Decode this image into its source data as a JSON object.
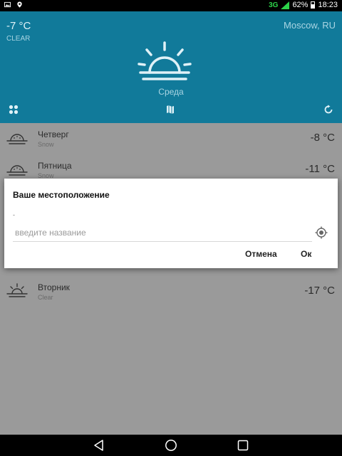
{
  "status_bar": {
    "network": "3G",
    "battery": "62%",
    "time": "18:23",
    "icons": [
      "image-icon",
      "location-icon",
      "signal-icon",
      "battery-icon"
    ]
  },
  "header": {
    "temperature": "-7 °C",
    "condition": "CLEAR",
    "location": "Moscow, RU",
    "day": "Среда",
    "icon": "sunrise-icon",
    "actions": [
      "grid-icon",
      "map-icon",
      "refresh-icon"
    ],
    "colors": {
      "background": "#117a9a"
    }
  },
  "forecast": [
    {
      "day": "Четверг",
      "condition": "Snow",
      "temp": "-8 °C",
      "icon": "snow-icon"
    },
    {
      "day": "Пятница",
      "condition": "Snow",
      "temp": "-11 °C",
      "icon": "snow-icon"
    },
    {
      "day": "Вторник",
      "condition": "Clear",
      "temp": "-17 °C",
      "icon": "sunrise-icon"
    }
  ],
  "dialog": {
    "title": "Ваше местоположение",
    "note": "-",
    "input_value": "",
    "input_placeholder": "введите название",
    "locate_icon": "gps-icon",
    "cancel_label": "Отмена",
    "ok_label": "Ок"
  },
  "nav_bar": {
    "buttons": [
      "back-icon",
      "home-icon",
      "recent-apps-icon"
    ]
  }
}
